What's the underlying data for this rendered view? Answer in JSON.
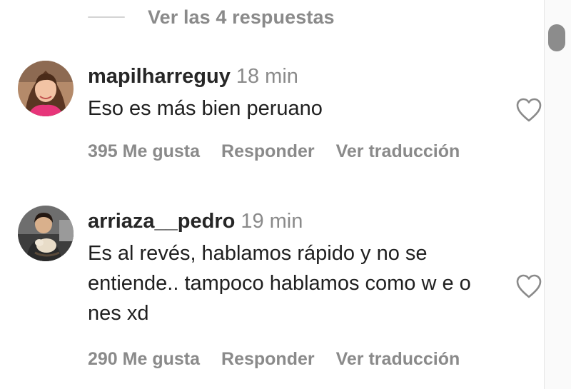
{
  "replies_toggle": {
    "label": "Ver las 4 respuestas"
  },
  "comments": [
    {
      "username": "mapilharreguy",
      "time": "18 min",
      "text": "Eso es más bien peruano",
      "likes": "395 Me gusta",
      "reply": "Responder",
      "translate": "Ver traducción",
      "like_icon": "heart-outline-icon"
    },
    {
      "username": "arriaza__pedro",
      "time": "19 min",
      "text": "Es al revés, hablamos rápido y no se entiende.. tampoco hablamos como w e o nes xd",
      "likes": "290 Me gusta",
      "reply": "Responder",
      "translate": "Ver traducción",
      "like_icon": "heart-outline-icon"
    }
  ],
  "colors": {
    "secondary_text": "#8a8a8a",
    "primary_text": "#262626",
    "divider": "#d4d4d4",
    "scroll_thumb": "#8c8c8c"
  }
}
